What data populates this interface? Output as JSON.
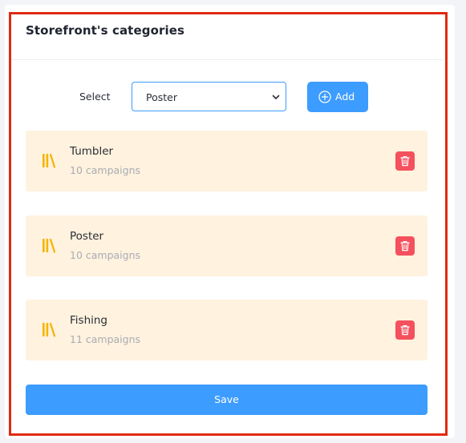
{
  "header": {
    "title": "Storefront's categories"
  },
  "select": {
    "label": "Select",
    "value": "Poster"
  },
  "add_button": {
    "label": "Add",
    "icon": "plus-circle-icon"
  },
  "categories": [
    {
      "name": "Tumbler",
      "count_text": "10 campaigns",
      "icon": "books-icon",
      "delete_icon": "trash-icon"
    },
    {
      "name": "Poster",
      "count_text": "10 campaigns",
      "icon": "books-icon",
      "delete_icon": "trash-icon"
    },
    {
      "name": "Fishing",
      "count_text": "11 campaigns",
      "icon": "books-icon",
      "delete_icon": "trash-icon"
    }
  ],
  "save_button": {
    "label": "Save"
  },
  "colors": {
    "accent": "#3d9cff",
    "card_background": "#fff2de",
    "delete": "#f5505e",
    "category_icon": "#f4b400",
    "highlight_frame": "#e02a12"
  }
}
